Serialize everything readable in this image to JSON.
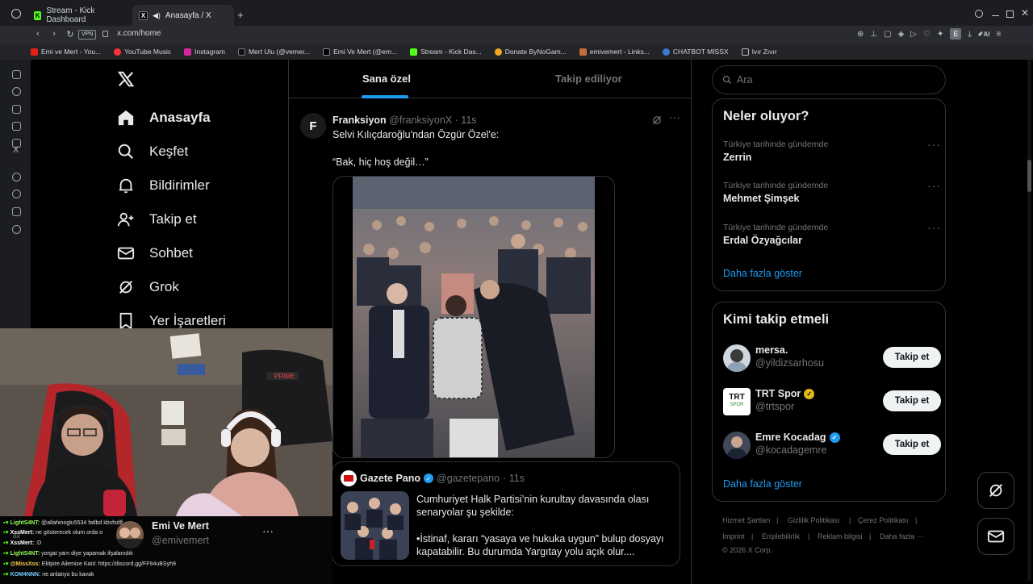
{
  "browser": {
    "tabs": [
      {
        "label": "Stream - Kick Dashboard",
        "icon": "kick-icon",
        "active": false
      },
      {
        "label": "Anasayfa / X",
        "icon": "x-icon",
        "active": true
      }
    ],
    "url": "x.com/home",
    "vpn_label": "VPN",
    "ai_label": "AI",
    "profile_letter": "E",
    "bookmarks": [
      "Emi ve Mert - You...",
      "YouTube Music",
      "Instagram",
      "Mert Ulu (@vemer...",
      "Emi Ve Mert (@em...",
      "Stream - Kick Das...",
      "Donate ByNoGam...",
      "emivemert - Links...",
      "CHATBOT MİSSX",
      "Ivır Zıvır"
    ]
  },
  "x": {
    "nav": [
      {
        "label": "Anasayfa",
        "icon": "home-icon"
      },
      {
        "label": "Keşfet",
        "icon": "search-icon"
      },
      {
        "label": "Bildirimler",
        "icon": "bell-icon"
      },
      {
        "label": "Takip et",
        "icon": "follow-icon"
      },
      {
        "label": "Sohbet",
        "icon": "mail-icon"
      },
      {
        "label": "Grok",
        "icon": "grok-icon"
      },
      {
        "label": "Yer İşaretleri",
        "icon": "bookmark-icon"
      }
    ],
    "feed_tabs": [
      "Sana özel",
      "Takip ediliyor"
    ],
    "post1": {
      "author": "Franksiyon",
      "handle": "@franksiyonX",
      "time": "· 11s",
      "line1": "Selvi Kılıçdaroğlu'ndan Özgür Özel'e:",
      "line2": "“Bak, hiç hoş değil…”",
      "avatar_letter": "F"
    },
    "post2": {
      "author": "Gazete Pano",
      "handle": "@gazetepano",
      "time": "· 11s",
      "text1": "Cumhuriyet Halk Partisi’nin kurultay davasında olası senaryolar şu şekilde:",
      "text2": "•İstinaf, kararı “yasaya ve hukuka uygun” bulup dosyayı kapatabilir. Bu durumda Yargıtay yolu açık olur...."
    },
    "search_placeholder": "Ara",
    "trends": {
      "title": "Neler oluyor?",
      "items": [
        {
          "meta": "Türkiye tarihinde gündemde",
          "name": "Zerrin"
        },
        {
          "meta": "Türkiye tarihinde gündemde",
          "name": "Mehmet Şimşek"
        },
        {
          "meta": "Türkiye tarihinde gündemde",
          "name": "Erdal Özyağcılar"
        }
      ],
      "show_more": "Daha fazla göster"
    },
    "who": {
      "title": "Kimi takip etmeli",
      "items": [
        {
          "name": "mersa.",
          "handle": "@yildizsarhosu",
          "verified": "none",
          "button": "Takip et"
        },
        {
          "name": "TRT Spor",
          "handle": "@trtspor",
          "verified": "gold",
          "button": "Takip et",
          "logo": "TRT",
          "logo_sub": "SPOR"
        },
        {
          "name": "Emre Kocadag",
          "handle": "@kocadagemre",
          "verified": "blue",
          "button": "Takip et"
        }
      ],
      "show_more": "Daha fazla göster"
    },
    "footer": [
      "Hizmet Şartları",
      "|",
      "Gizlilik Politikası",
      "|",
      "Çerez Politikası",
      "|",
      "Imprint",
      "|",
      "Erişilebilirlik",
      "|",
      "Reklam bilgisi",
      "|",
      "Daha fazla ···",
      "© 2026 X Corp."
    ],
    "account": {
      "name": "Emi Ve Mert",
      "handle": "@emivemert",
      "more": "···"
    }
  },
  "stream": {
    "chair_brand": "PRIME",
    "chat": [
      {
        "user": "LightS4NT:",
        "msg": "@allahinoglu5534 fatlbd kbsfsdlf"
      },
      {
        "user": "XssMert:",
        "msg": "ne gösterecek olum orda o"
      },
      {
        "user": "XssMert:",
        "msg": ":D"
      },
      {
        "user": "LightS4NT:",
        "msg": "yorgat yarn diye yapamak ifşalanıdık"
      },
      {
        "user": "@MissXss:",
        "msg": "EMpire Ailemize Katıl: https://discord.gg/FF94uBSyh9"
      },
      {
        "user": "KOM4NNN:",
        "msg": "ne anlatıyo bu kavak"
      }
    ],
    "chat_prefix": "GX"
  },
  "colors": {
    "accent": "#1d9bf0",
    "gold": "#e2b719",
    "kick": "#53fc18",
    "bg": "#000000",
    "border": "#2f3336"
  }
}
